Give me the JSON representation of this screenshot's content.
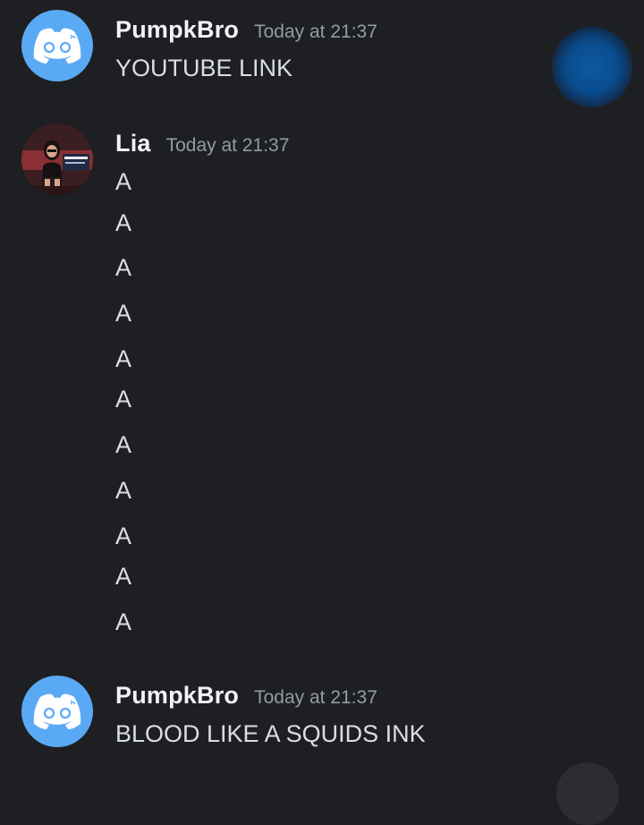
{
  "messages": [
    {
      "username": "PumpkBro",
      "timestamp": "Today at 21:37",
      "avatar_icon": "discord-logo-icon",
      "lines": [
        "YOUTUBE LINK"
      ]
    },
    {
      "username": "Lia",
      "timestamp": "Today at 21:37",
      "avatar_icon": "user-photo",
      "lines": [
        "A",
        "A",
        "A",
        "A",
        "A",
        "A",
        "A",
        "A",
        "A",
        "A",
        "A"
      ]
    },
    {
      "username": "PumpkBro",
      "timestamp": "Today at 21:37",
      "avatar_icon": "discord-logo-icon",
      "lines": [
        "BLOOD LIKE A SQUIDS INK"
      ]
    }
  ],
  "colors": {
    "background": "#1e1f22",
    "username": "#f2f3f5",
    "timestamp": "#949ba4",
    "message_text": "#dbdee1",
    "discord_avatar": "#5aa9f5",
    "floating_button": "#0b5aa3"
  }
}
